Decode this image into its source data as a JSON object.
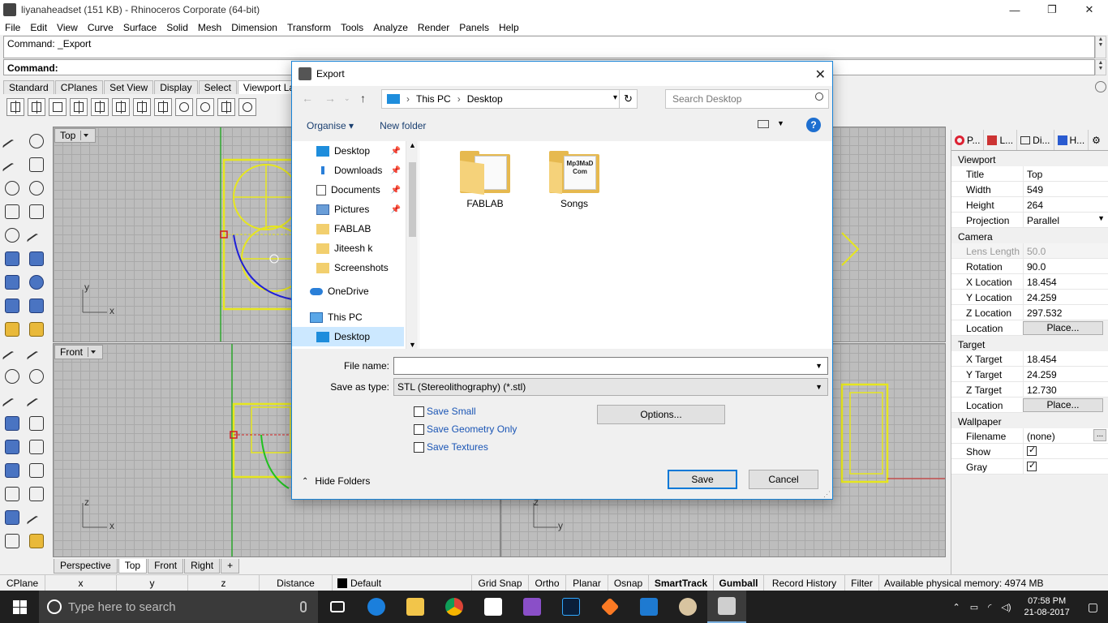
{
  "window": {
    "title": "liyanaheadset (151 KB) - Rhinoceros Corporate (64-bit)",
    "controls": [
      "—",
      "❐",
      "✕"
    ]
  },
  "menu": [
    "File",
    "Edit",
    "View",
    "Curve",
    "Surface",
    "Solid",
    "Mesh",
    "Dimension",
    "Transform",
    "Tools",
    "Analyze",
    "Render",
    "Panels",
    "Help"
  ],
  "command": {
    "history": "Command: _Export",
    "prompt": "Command:"
  },
  "toolbar_tabs": [
    "Standard",
    "CPlanes",
    "Set View",
    "Display",
    "Select",
    "Viewport Lay"
  ],
  "viewports": {
    "top_label": "Top",
    "front_label": "Front",
    "axis_y": "y",
    "axis_x": "x",
    "axis_z": "z",
    "axis_z2": "z",
    "axis_x2": "x",
    "axis_y2": "y"
  },
  "viewport_tabs": [
    "Perspective",
    "Top",
    "Front",
    "Right",
    "+"
  ],
  "statusbar": {
    "cplane": "CPlane",
    "x": "x",
    "y": "y",
    "z": "z",
    "distance": "Distance",
    "layer": "Default",
    "grid_snap": "Grid Snap",
    "ortho": "Ortho",
    "planar": "Planar",
    "osnap": "Osnap",
    "smarttrack": "SmartTrack",
    "gumball": "Gumball",
    "record_history": "Record History",
    "filter": "Filter",
    "memory": "Available physical memory: 4974 MB"
  },
  "taskbar": {
    "search_placeholder": "Type here to search",
    "time": "07:58 PM",
    "date": "21-08-2017"
  },
  "right_panel": {
    "tabs": [
      "P...",
      "L...",
      "Di...",
      "H..."
    ],
    "sections": {
      "viewport": "Viewport",
      "camera": "Camera",
      "target": "Target",
      "wallpaper": "Wallpaper"
    },
    "viewport_rows": [
      {
        "k": "Title",
        "v": "Top"
      },
      {
        "k": "Width",
        "v": "549"
      },
      {
        "k": "Height",
        "v": "264"
      },
      {
        "k": "Projection",
        "v": "Parallel"
      }
    ],
    "camera_rows": [
      {
        "k": "Lens Length",
        "v": "50.0"
      },
      {
        "k": "Rotation",
        "v": "90.0"
      },
      {
        "k": "X Location",
        "v": "18.454"
      },
      {
        "k": "Y Location",
        "v": "24.259"
      },
      {
        "k": "Z Location",
        "v": "297.532"
      },
      {
        "k": "Location",
        "v": "Place..."
      }
    ],
    "target_rows": [
      {
        "k": "X Target",
        "v": "18.454"
      },
      {
        "k": "Y Target",
        "v": "24.259"
      },
      {
        "k": "Z Target",
        "v": "12.730"
      },
      {
        "k": "Location",
        "v": "Place..."
      }
    ],
    "wallpaper_rows": [
      {
        "k": "Filename",
        "v": "(none)"
      },
      {
        "k": "Show",
        "v": ""
      },
      {
        "k": "Gray",
        "v": ""
      }
    ],
    "more_button": "..."
  },
  "dialog": {
    "title": "Export",
    "path": [
      "This PC",
      "Desktop"
    ],
    "search_placeholder": "Search Desktop",
    "organise": "Organise ▾",
    "new_folder": "New folder",
    "help": "?",
    "nav_items": [
      {
        "label": "Desktop",
        "pinned": true
      },
      {
        "label": "Downloads",
        "pinned": true
      },
      {
        "label": "Documents",
        "pinned": true
      },
      {
        "label": "Pictures",
        "pinned": true
      },
      {
        "label": "FABLAB",
        "pinned": false
      },
      {
        "label": "Jiteesh k",
        "pinned": false
      },
      {
        "label": "Screenshots",
        "pinned": false
      },
      {
        "label": "OneDrive",
        "pinned": false
      },
      {
        "label": "This PC",
        "pinned": false
      },
      {
        "label": "Desktop",
        "pinned": false
      }
    ],
    "folders": [
      "FABLAB",
      "Songs"
    ],
    "songs_cover_text": "Mp3MaD Com",
    "file_name_label": "File name:",
    "file_name_value": "",
    "save_type_label": "Save as type:",
    "save_type_value": "STL (Stereolithography) (*.stl)",
    "options": [
      "Save Small",
      "Save Geometry Only",
      "Save Textures"
    ],
    "options_button": "Options...",
    "hide_folders": "Hide Folders",
    "save": "Save",
    "cancel": "Cancel"
  }
}
